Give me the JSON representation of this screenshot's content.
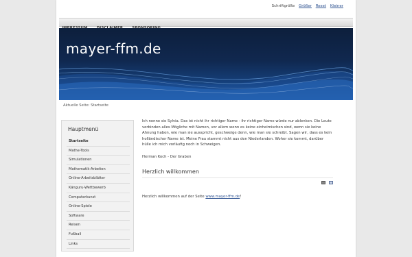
{
  "header": {
    "fontsize_label": "Schriftgröße",
    "fontsize_larger": "Größer",
    "fontsize_reset": "Reset",
    "fontsize_smaller": "Kleiner"
  },
  "topnav": {
    "items": [
      {
        "label": "IMPRESSUM"
      },
      {
        "label": "DISCLAIMER"
      },
      {
        "label": "SPONSORING"
      }
    ]
  },
  "banner": {
    "site_title": "mayer-ffm.de"
  },
  "breadcrumb": {
    "text": "Aktuelle Seite: Startseite"
  },
  "sidebar": {
    "title": "Hauptmenü",
    "items": [
      {
        "label": "Startseite",
        "active": true
      },
      {
        "label": "Mathe-Tools"
      },
      {
        "label": "Simulationen"
      },
      {
        "label": "Mathematik-Arbeiten"
      },
      {
        "label": "Online-Arbeitsblätter"
      },
      {
        "label": "Känguru-Wettbewerb"
      },
      {
        "label": "Computerkunst"
      },
      {
        "label": "Online-Spiele"
      },
      {
        "label": "Software"
      },
      {
        "label": "Reisen"
      },
      {
        "label": "Fußball"
      },
      {
        "label": "Links"
      }
    ]
  },
  "content": {
    "quote": "Ich nenne sie Sylvia. Das ist nicht ihr richtiger Name - ihr richtiger Name würde nur ablenken. Die Leute verbinden alles Mögliche mit Namen, vor allem wenn es keine einheimischen sind, wenn sie keine Ahnung haben, wie man sie ausspricht, geschweige denn, wie man sie schreibt. Sagen wir, dass es kein holländischer Name ist. Meine Frau stammt nicht aus den Niederlanden. Woher sie kommt, darüber hülle ich mich vorläufig noch in Schweigen.",
    "quote_author": "Herman Koch - Der Graben",
    "heading": "Herzlich willkommen",
    "welcome_prefix": "Herzlich willkommen auf der Seite ",
    "welcome_link": "www.mayer-ffm.de",
    "welcome_suffix": "!"
  }
}
